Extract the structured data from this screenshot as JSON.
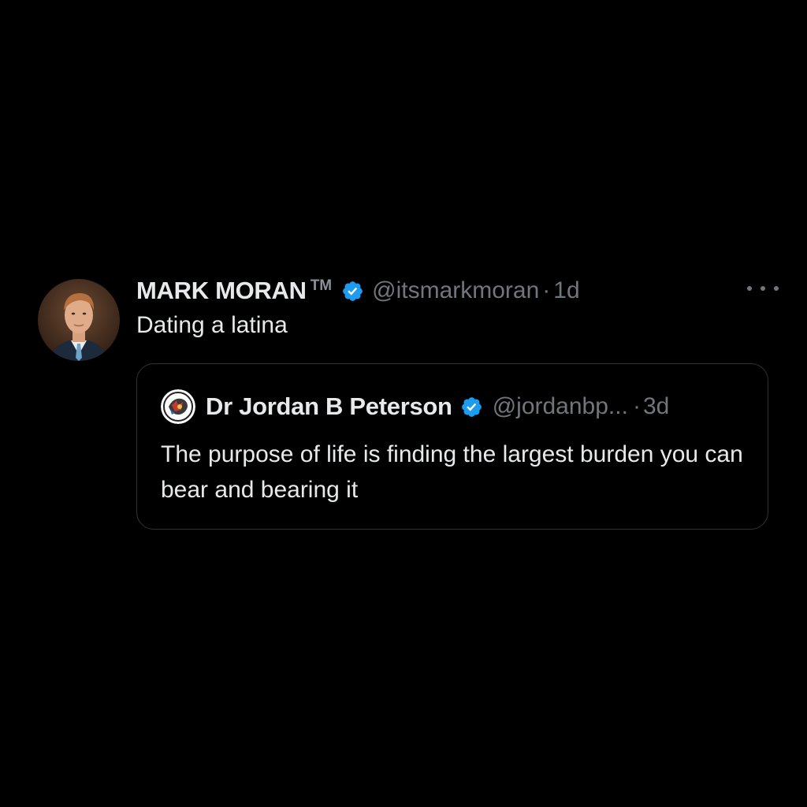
{
  "tweet": {
    "display_name": "MARK MORAN",
    "trademark": "TM",
    "handle": "@itsmarkmoran",
    "separator": "·",
    "time": "1d",
    "text": "Dating a latina",
    "avatar_icon": "profile-photo-avatar",
    "verified_icon": "verified-badge-icon",
    "more_icon": "more-options-icon"
  },
  "quote": {
    "display_name": "Dr Jordan B Peterson",
    "handle": "@jordanbp...",
    "separator": "·",
    "time": "3d",
    "text": "The purpose of life is finding the largest burden you can bear and bearing it",
    "avatar_icon": "profile-logo-avatar",
    "verified_icon": "verified-badge-icon"
  },
  "colors": {
    "background": "#000000",
    "primary_text": "#e7e9ea",
    "secondary_text": "#71767b",
    "verified_blue": "#1d9bf0",
    "border": "#2f3336"
  }
}
